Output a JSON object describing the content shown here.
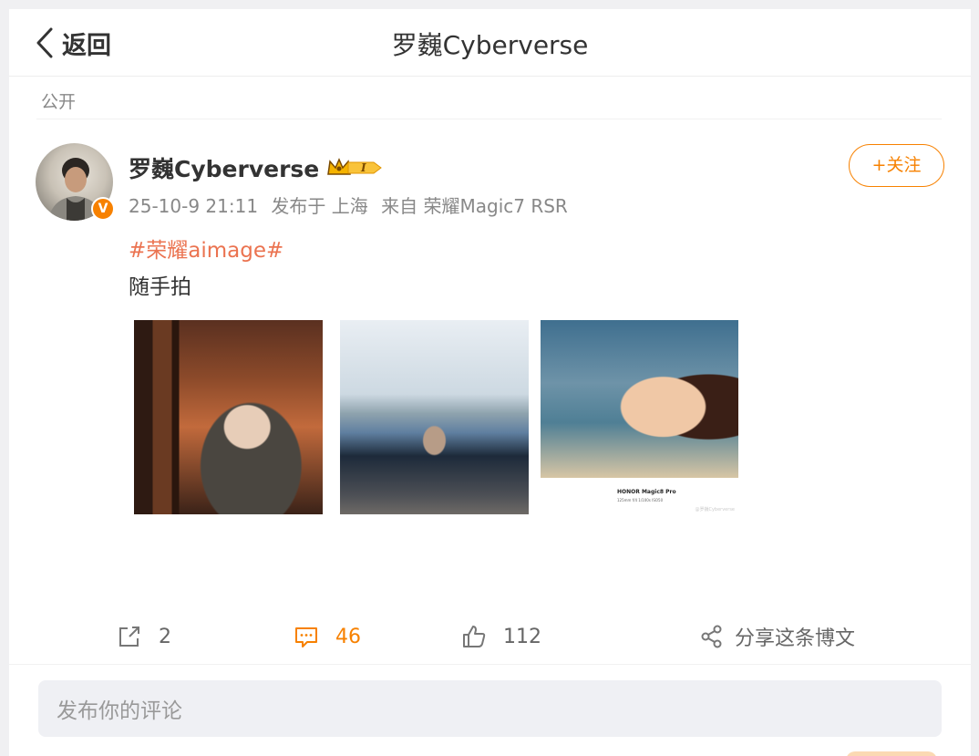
{
  "header": {
    "back_label": "返回",
    "title": "罗巍Cyberverse"
  },
  "visibility": "公开",
  "post": {
    "username": "罗巍Cyberverse",
    "member_badge_text": "I",
    "verified_mark": "V",
    "meta": {
      "datetime": "25-10-9 21:11",
      "location": "发布于 上海",
      "source": "来自 荣耀Magic7 RSR"
    },
    "follow_label": "+关注",
    "hashtag": "#荣耀aimage#",
    "text": "随手拍",
    "photos": [
      {
        "alt": "photo-1"
      },
      {
        "alt": "photo-2"
      },
      {
        "alt": "photo-3",
        "camera": "HONOR Magic8 Pro",
        "camera_sub": "125mm f/4 1/100s ISO50",
        "watermark": "@罗巍Cyberverse"
      }
    ]
  },
  "actions": {
    "repost_count": "2",
    "comment_count": "46",
    "like_count": "112",
    "share_label": "分享这条博文"
  },
  "comment_box": {
    "placeholder": "发布你的评论"
  },
  "colors": {
    "accent": "#f78100",
    "hashtag": "#eb7350",
    "muted": "#888888"
  }
}
